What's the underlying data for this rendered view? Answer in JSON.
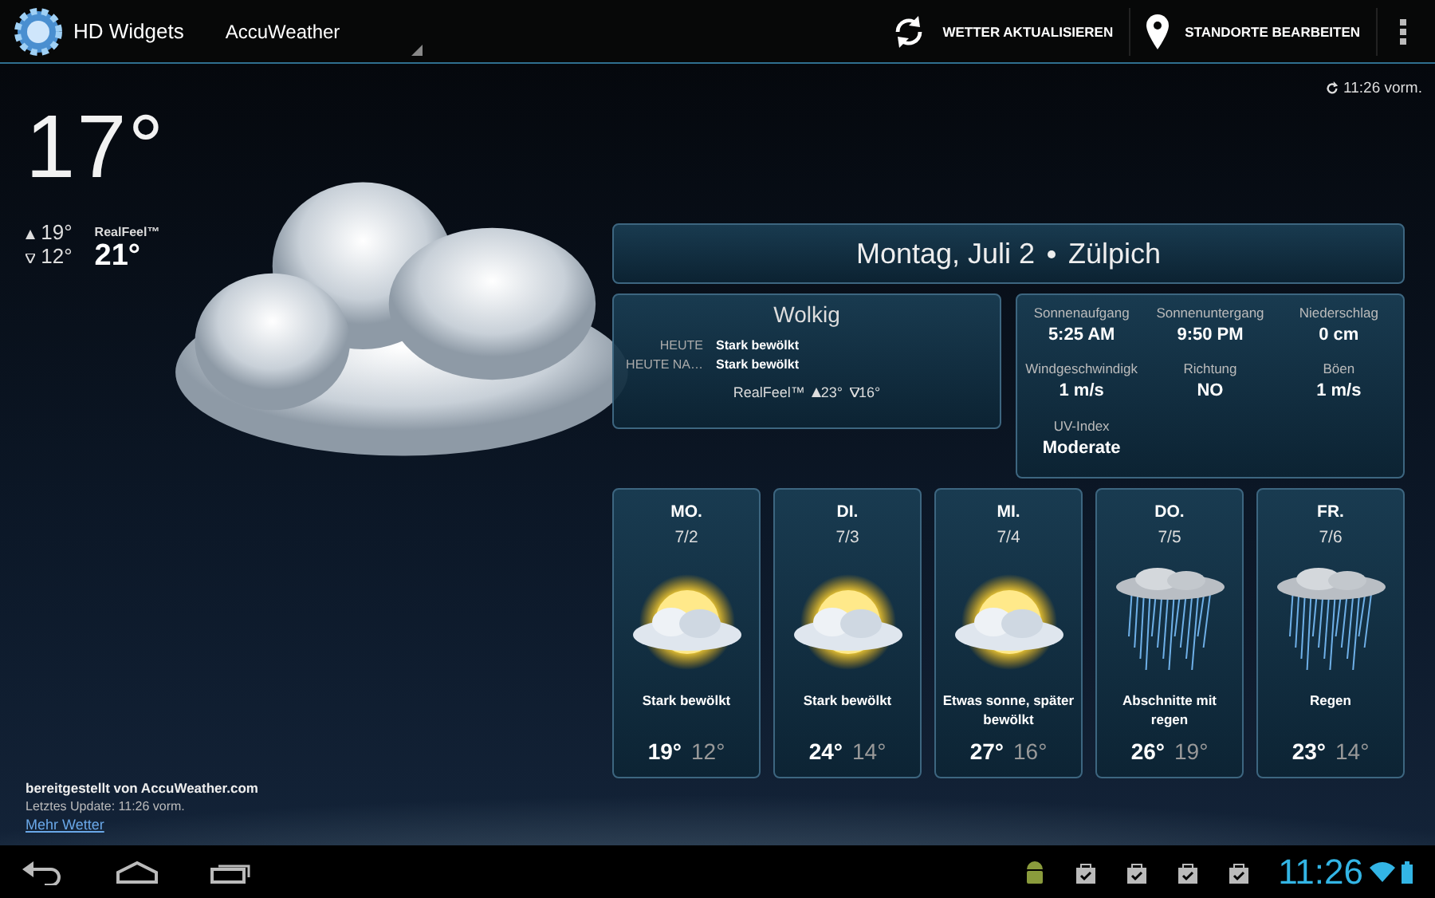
{
  "action_bar": {
    "app_title": "HD Widgets",
    "provider": "AccuWeather",
    "actions": [
      {
        "kind": "refresh",
        "label": "WETTER AKTUALISIEREN"
      },
      {
        "kind": "location",
        "label": "STANDORTE BEARBEITEN"
      }
    ]
  },
  "updated": "11:26 vorm.",
  "current": {
    "temperature": "17°",
    "high": "19°",
    "low": "12°",
    "realfeel_label": "RealFeel™",
    "realfeel": "21°"
  },
  "header": {
    "date": "Montag, Juli 2",
    "location": "Zülpich"
  },
  "summary": {
    "condition": "Wolkig",
    "rows": [
      {
        "label": "HEUTE",
        "value": "Stark bewölkt"
      },
      {
        "label": "HEUTE NA…",
        "value": "Stark bewölkt"
      }
    ],
    "realfeel_label": "RealFeel™",
    "high": "23°",
    "low": "16°"
  },
  "details": [
    {
      "label": "Sonnenaufgang",
      "value": "5:25 AM"
    },
    {
      "label": "Sonnenuntergang",
      "value": "9:50 PM"
    },
    {
      "label": "Niederschlag",
      "value": "0 cm"
    },
    {
      "label": "Windgeschwindigk",
      "value": "1 m/s"
    },
    {
      "label": "Richtung",
      "value": "NO"
    },
    {
      "label": "Böen",
      "value": "1 m/s"
    },
    {
      "label": "UV-Index",
      "value": "Moderate"
    }
  ],
  "forecast": [
    {
      "day": "MO.",
      "date": "7/2",
      "kind": "partly-sunny",
      "condition": "Stark bewölkt",
      "high": "19°",
      "low": "12°"
    },
    {
      "day": "DI.",
      "date": "7/3",
      "kind": "partly-sunny",
      "condition": "Stark bewölkt",
      "high": "24°",
      "low": "14°"
    },
    {
      "day": "MI.",
      "date": "7/4",
      "kind": "partly-sunny",
      "condition": "Etwas sonne, später bewölkt",
      "high": "27°",
      "low": "16°"
    },
    {
      "day": "DO.",
      "date": "7/5",
      "kind": "rain",
      "condition": "Abschnitte mit regen",
      "high": "26°",
      "low": "19°"
    },
    {
      "day": "FR.",
      "date": "7/6",
      "kind": "rain",
      "condition": "Regen",
      "high": "23°",
      "low": "14°"
    }
  ],
  "footer": {
    "credit": "bereitgestellt von AccuWeather.com",
    "last_update": "Letztes Update: 11:26 vorm.",
    "link": "Mehr Wetter"
  },
  "status_bar": {
    "time": "11:26"
  }
}
